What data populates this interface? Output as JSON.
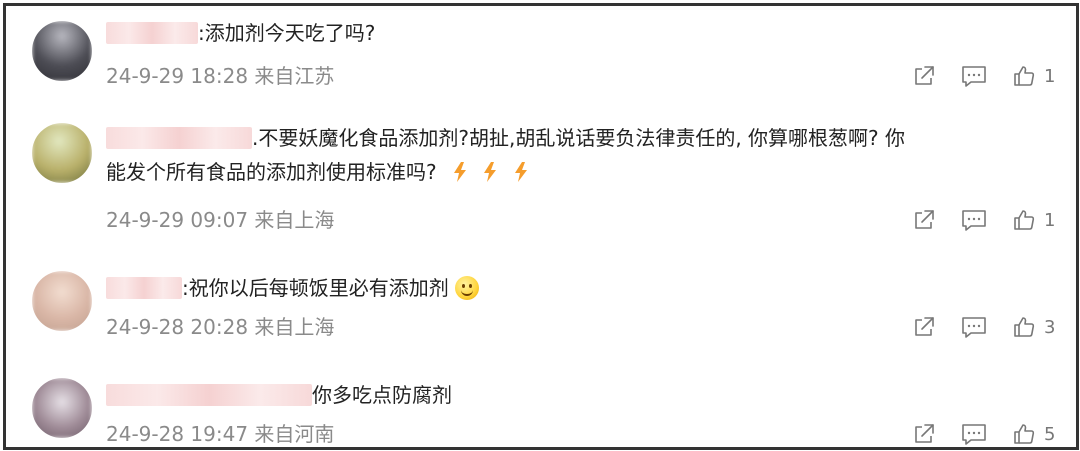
{
  "comments": [
    {
      "text": ":添加剂今天吃了吗?",
      "time": "24-9-29 18:28",
      "location": "来自江苏",
      "likes": "1",
      "avatar_colors": [
        "#b8b8c0",
        "#4d4d55",
        "#2f2f35"
      ]
    },
    {
      "text_line1": ".不要妖魔化食品添加剂?胡扯,胡乱说话要负法律责任的,  你算哪根葱啊?  你",
      "text_line2": "能发个所有食品的添加剂使用标准吗?",
      "time": "24-9-29 09:07",
      "location": "来自上海",
      "likes": "1",
      "avatar_colors": [
        "#e2e8c0",
        "#b9b06a",
        "#6a6e3a"
      ]
    },
    {
      "text": ":祝你以后每顿饭里必有添加剂",
      "time": "24-9-28 20:28",
      "location": "来自上海",
      "likes": "3",
      "avatar_colors": [
        "#f2ddd0",
        "#d9b6a6",
        "#c0a08f"
      ]
    },
    {
      "text": "你多吃点防腐剂",
      "time": "24-9-28 19:47",
      "location": "来自河南",
      "likes": "5",
      "avatar_colors": [
        "#e6e0e6",
        "#a08c98",
        "#6b5a66"
      ]
    }
  ],
  "icons": {
    "share": "share-icon",
    "comment": "comment-icon",
    "like": "thumbs-up-icon",
    "fire": "fire-emoji",
    "smile": "smile-emoji"
  },
  "colors": {
    "fire": "#f59d2c",
    "meta": "#8a8a8a",
    "text": "#222222",
    "border": "#333333"
  }
}
